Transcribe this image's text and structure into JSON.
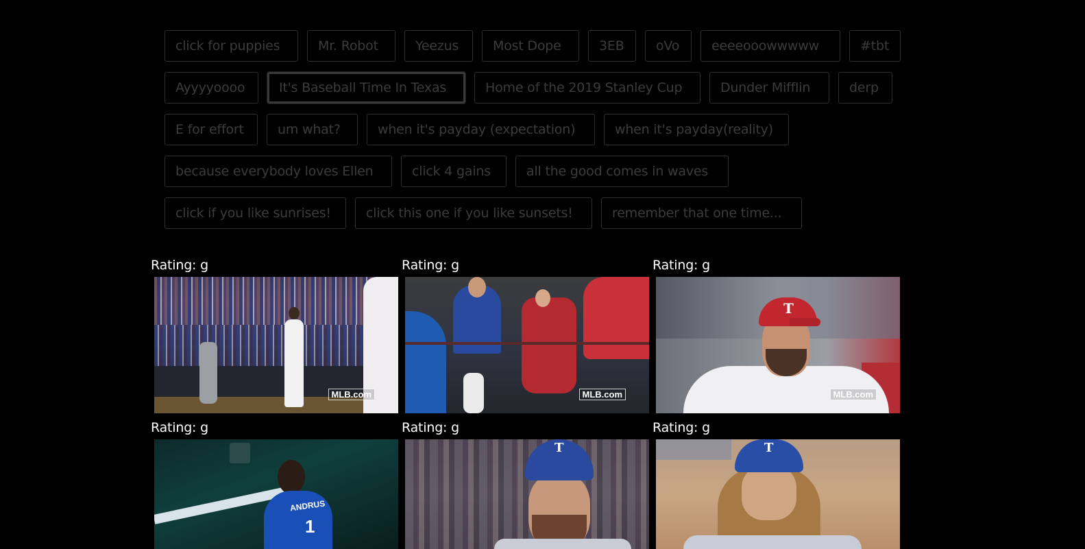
{
  "topics": {
    "rows": [
      [
        "click for puppies",
        "Mr. Robot",
        "Yeezus",
        "Most Dope",
        "3EB",
        "oVo",
        "eeeeooowwwww",
        "#tbt"
      ],
      [
        "Ayyyyoooo",
        "It's Baseball Time In Texas",
        "Home of the 2019 Stanley Cup",
        "Dunder Mifflin",
        "derp"
      ],
      [
        "E for effort",
        "um what?",
        "when it's payday (expectation)",
        "when it's payday(reality)"
      ],
      [
        "because everybody loves Ellen",
        "click 4 gains",
        "all the good comes in waves"
      ],
      [
        "click if you like sunrises!",
        "click this one if you like sunsets!",
        "remember that one time..."
      ]
    ],
    "focused": "It's Baseball Time In Texas"
  },
  "gifs": [
    {
      "rating": "Rating: g",
      "watermark": "MLB.com",
      "scene": "player-celebrating-at-home-plate"
    },
    {
      "rating": "Rating: g",
      "watermark": "MLB.com",
      "scene": "fans-cheering-in-stands"
    },
    {
      "rating": "Rating: g",
      "watermark": "MLB.com",
      "scene": "pitcher-in-red-cap"
    },
    {
      "rating": "Rating: g",
      "watermark": "",
      "scene": "player-andrus-in-dugout"
    },
    {
      "rating": "Rating: g",
      "watermark": "",
      "scene": "bearded-player-in-helmet"
    },
    {
      "rating": "Rating: g",
      "watermark": "",
      "scene": "long-haired-pitcher"
    }
  ],
  "colors": {
    "background": "#000000",
    "button_border": "#2e2e2e",
    "button_text": "#3c3c3c",
    "rating_text": "#ffffff"
  }
}
